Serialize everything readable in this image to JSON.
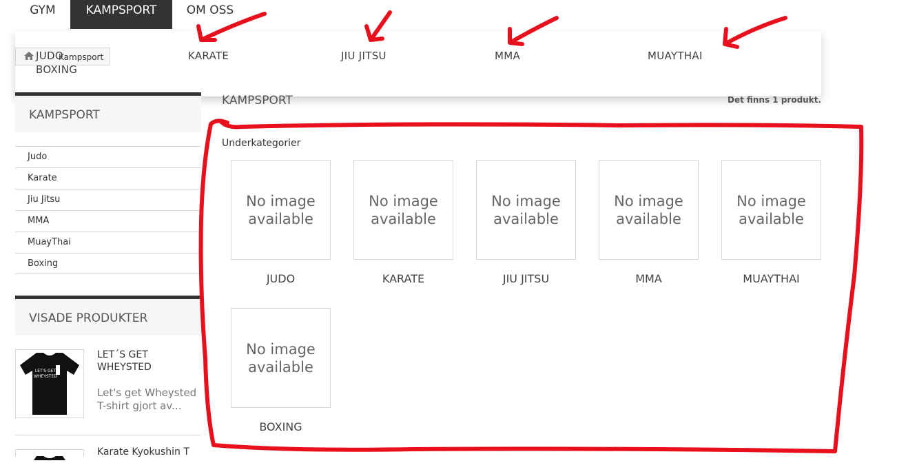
{
  "topnav": {
    "items": [
      {
        "label": "GYM",
        "active": false
      },
      {
        "label": "KAMPSPORT",
        "active": true
      },
      {
        "label": "OM OSS",
        "active": false
      }
    ]
  },
  "dropdown": {
    "items": [
      "JUDO",
      "BOXING",
      "KARATE",
      "JIU JITSU",
      "MMA",
      "MUAYTHAI"
    ]
  },
  "breadcrumb": {
    "icon": "home-icon",
    "label": "Kampsport"
  },
  "sidebar": {
    "categories_title": "KAMPSPORT",
    "categories": [
      "Judo",
      "Karate",
      "Jiu Jitsu",
      "MMA",
      "MuayThai",
      "Boxing"
    ],
    "viewed_title": "VISADE PRODUKTER",
    "products": [
      {
        "name": "LET´S GET WHEYSTED",
        "desc": "Let's get Wheysted T-shirt gjort av...",
        "image_text": "LET'S GET WHEYSTED"
      },
      {
        "name": "Karate Kyokushin T"
      }
    ]
  },
  "main": {
    "title": "KAMPSPORT",
    "count": "Det finns 1 produkt.",
    "subcategories_title": "Underkategorier",
    "placeholder": "No image available",
    "subcategories": [
      "JUDO",
      "KARATE",
      "JIU JITSU",
      "MMA",
      "MUAYTHAI",
      "BOXING"
    ]
  },
  "colors": {
    "dark": "#333333",
    "annotation": "#e8101d",
    "border": "#d6d6d6"
  }
}
